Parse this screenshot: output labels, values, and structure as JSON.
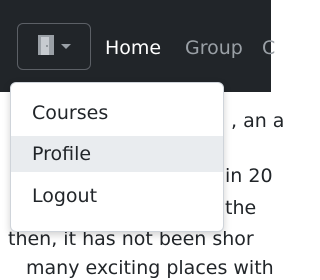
{
  "navbar": {
    "toggle_icon": "door-icon",
    "links": [
      "Home",
      "Group",
      "C"
    ]
  },
  "dropdown": {
    "items": [
      {
        "label": "Courses",
        "active": false
      },
      {
        "label": "Profile",
        "active": true
      },
      {
        "label": "Logout",
        "active": false
      }
    ]
  },
  "content": {
    "lines": [
      ", an a",
      "in 20",
      "the",
      "then, it has not been shor",
      "many exciting places with"
    ]
  },
  "colors": {
    "navbar_bg": "#212529",
    "active_link": "#ffffff",
    "inactive_link": "#9aa0a6",
    "dropdown_hover": "#e9ecef"
  }
}
